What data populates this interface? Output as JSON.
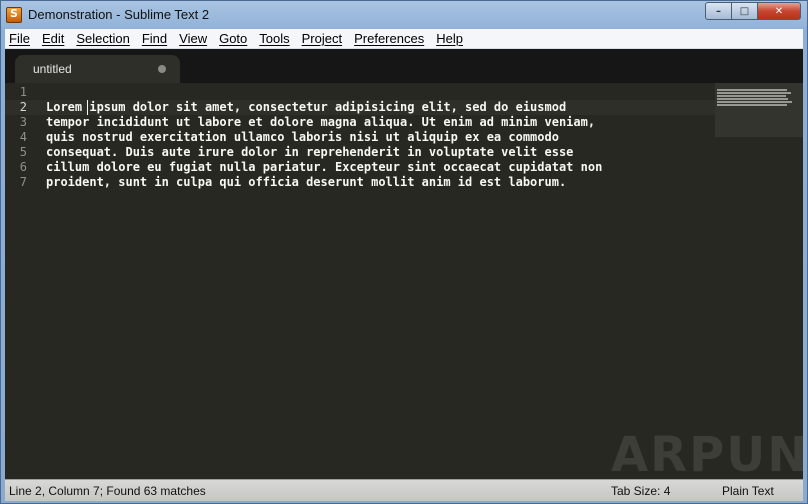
{
  "window": {
    "title": "Demonstration - Sublime Text 2"
  },
  "controls": {
    "minimize": "–",
    "maximize": "□",
    "close": "✕"
  },
  "menu": [
    "File",
    "Edit",
    "Selection",
    "Find",
    "View",
    "Goto",
    "Tools",
    "Project",
    "Preferences",
    "Help"
  ],
  "tab": {
    "label": "untitled"
  },
  "editor": {
    "line_numbers": [
      "1",
      "2",
      "3",
      "4",
      "5",
      "6",
      "7"
    ],
    "lines": [
      "",
      "Lorem ipsum dolor sit amet, consectetur adipisicing elit, sed do eiusmod",
      "tempor incididunt ut labore et dolore magna aliqua. Ut enim ad minim veniam,",
      "quis nostrud exercitation ullamco laboris nisi ut aliquip ex ea commodo",
      "consequat. Duis aute irure dolor in reprehenderit in voluptate velit esse",
      "cillum dolore eu fugiat nulla pariatur. Excepteur sint occaecat cupidatat non",
      "proident, sunt in culpa qui officia deserunt mollit anim id est laborum."
    ]
  },
  "watermark": "ARPUN",
  "status": {
    "position": "Line 2, Column 7; Found 63 matches",
    "tab_size": "Tab Size: 4",
    "syntax": "Plain Text"
  },
  "colors": {
    "editor_bg": "#272822",
    "text": "#f8f8f2",
    "gutter_text": "#8f908a"
  }
}
